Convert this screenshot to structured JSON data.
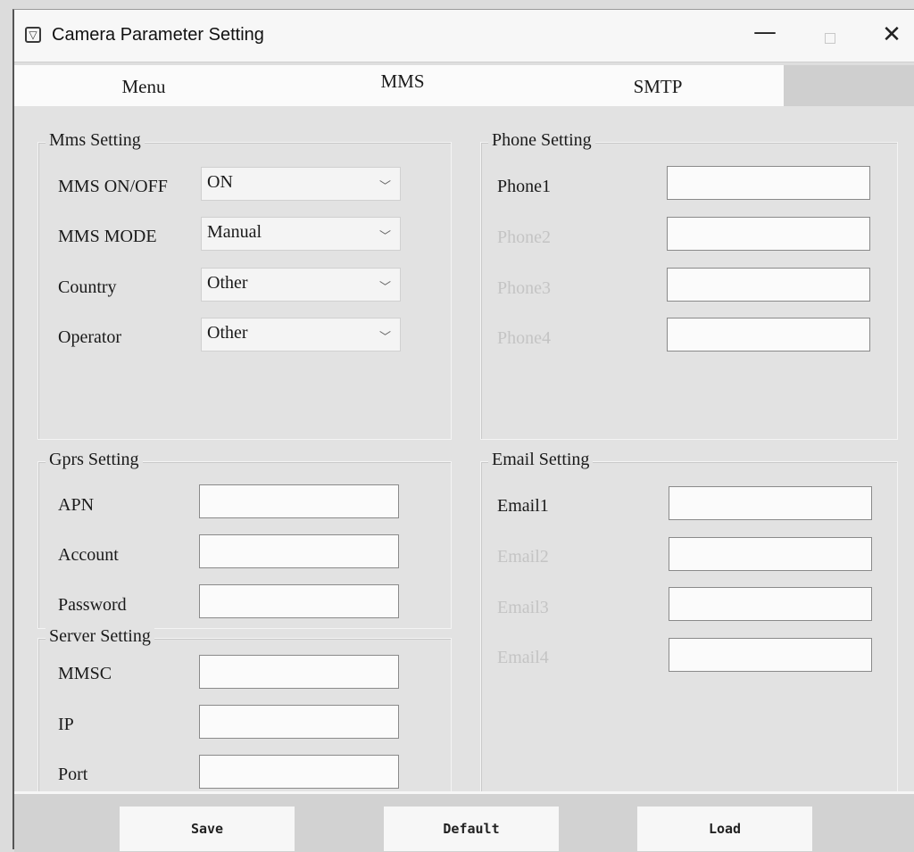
{
  "window": {
    "title": "Camera Parameter Setting",
    "controls": {
      "minimize": "—",
      "close": "✕"
    }
  },
  "tabs": [
    "Menu",
    "MMS",
    "SMTP"
  ],
  "mms_setting": {
    "title": "Mms Setting",
    "fields": [
      {
        "label": "MMS ON/OFF",
        "value": "ON"
      },
      {
        "label": "MMS MODE",
        "value": "Manual"
      },
      {
        "label": "Country",
        "value": "Other"
      },
      {
        "label": "Operator",
        "value": "Other"
      }
    ]
  },
  "phone_setting": {
    "title": "Phone Setting",
    "fields": [
      {
        "label": "Phone1",
        "value": "",
        "enabled": true
      },
      {
        "label": "Phone2",
        "value": "",
        "enabled": false
      },
      {
        "label": "Phone3",
        "value": "",
        "enabled": false
      },
      {
        "label": "Phone4",
        "value": "",
        "enabled": false
      }
    ]
  },
  "gprs_setting": {
    "title": "Gprs Setting",
    "fields": [
      {
        "label": "APN",
        "value": ""
      },
      {
        "label": "Account",
        "value": ""
      },
      {
        "label": "Password",
        "value": ""
      }
    ]
  },
  "server_setting": {
    "title": "Server Setting",
    "fields": [
      {
        "label": "MMSC",
        "value": ""
      },
      {
        "label": "IP",
        "value": ""
      },
      {
        "label": "Port",
        "value": ""
      }
    ]
  },
  "email_setting": {
    "title": "Email Setting",
    "fields": [
      {
        "label": "Email1",
        "value": "",
        "enabled": true
      },
      {
        "label": "Email2",
        "value": "",
        "enabled": false
      },
      {
        "label": "Email3",
        "value": "",
        "enabled": false
      },
      {
        "label": "Email4",
        "value": "",
        "enabled": false
      }
    ]
  },
  "buttons": {
    "save": "Save",
    "default": "Default",
    "load": "Load"
  },
  "icons": {
    "app": "camera-app-icon",
    "dropdown": "chevron-down-icon"
  },
  "colors": {
    "background": "#dedede",
    "input_bg": "#fbfbfb",
    "disabled_text": "#c4c4c4"
  }
}
